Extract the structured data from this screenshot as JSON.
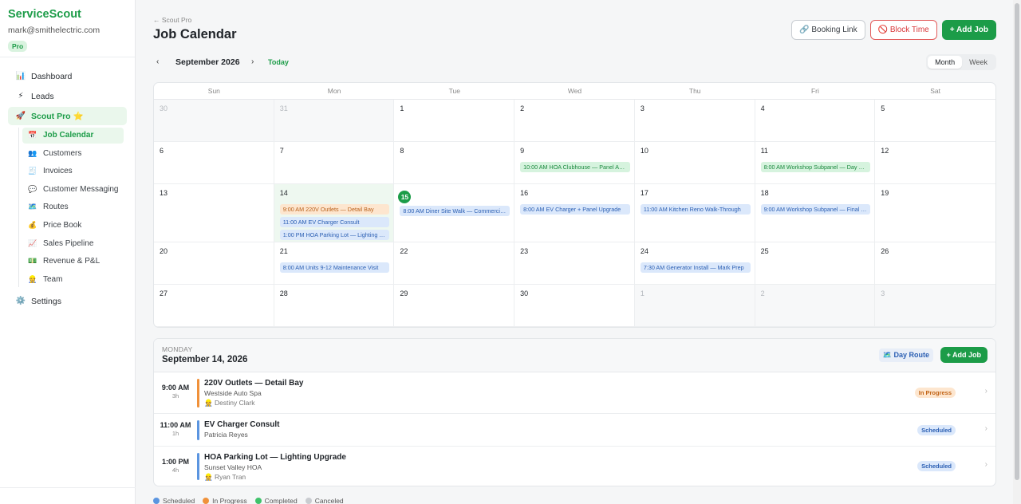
{
  "app": {
    "brand": "ServiceScout",
    "email": "mark@smithelectric.com",
    "plan": "Pro"
  },
  "sidebar": {
    "items": [
      {
        "name": "dashboard",
        "label": "Dashboard",
        "icon": "📊"
      },
      {
        "name": "leads",
        "label": "Leads",
        "icon": "⚡"
      },
      {
        "name": "scout-pro",
        "label": "Scout Pro ⭐",
        "icon": "🚀"
      }
    ],
    "sub_items": [
      {
        "name": "job-calendar",
        "label": "Job Calendar",
        "icon": "📅"
      },
      {
        "name": "customers",
        "label": "Customers",
        "icon": "👥"
      },
      {
        "name": "invoices",
        "label": "Invoices",
        "icon": "🧾"
      },
      {
        "name": "customer-messaging",
        "label": "Customer Messaging",
        "icon": "💬"
      },
      {
        "name": "routes",
        "label": "Routes",
        "icon": "🗺️"
      },
      {
        "name": "price-book",
        "label": "Price Book",
        "icon": "💰"
      },
      {
        "name": "sales-pipeline",
        "label": "Sales Pipeline",
        "icon": "📈"
      },
      {
        "name": "revenue-pl",
        "label": "Revenue & P&L",
        "icon": "💵"
      },
      {
        "name": "team",
        "label": "Team",
        "icon": "👷"
      }
    ],
    "settings": {
      "label": "Settings",
      "icon": "⚙️"
    }
  },
  "header": {
    "back_label": "← Scout Pro",
    "title": "Job Calendar",
    "booking_link": "🔗 Booking Link",
    "block_time": "🚫 Block Time",
    "add_job": "+ Add Job"
  },
  "month_bar": {
    "prev": "‹",
    "next": "›",
    "month": "September 2026",
    "today": "Today",
    "views": [
      "Month",
      "Week"
    ]
  },
  "calendar": {
    "weekdays": [
      "Sun",
      "Mon",
      "Tue",
      "Wed",
      "Thu",
      "Fri",
      "Sat"
    ],
    "weeks": [
      [
        {
          "d": "30",
          "other": true
        },
        {
          "d": "31",
          "other": true
        },
        {
          "d": "1"
        },
        {
          "d": "2"
        },
        {
          "d": "3"
        },
        {
          "d": "4"
        },
        {
          "d": "5"
        }
      ],
      [
        {
          "d": "6"
        },
        {
          "d": "7"
        },
        {
          "d": "8"
        },
        {
          "d": "9",
          "events": [
            {
              "text": "10:00 AM HOA Clubhouse — Panel Asse...",
              "status": "completed"
            }
          ]
        },
        {
          "d": "10"
        },
        {
          "d": "11",
          "events": [
            {
              "text": "8:00 AM Workshop Subpanel — Day 1 Ro...",
              "status": "completed"
            }
          ]
        },
        {
          "d": "12"
        }
      ],
      [
        {
          "d": "13"
        },
        {
          "d": "14",
          "selected": true,
          "events": [
            {
              "text": "9:00 AM 220V Outlets — Detail Bay",
              "status": "progress"
            },
            {
              "text": "11:00 AM EV Charger Consult",
              "status": "scheduled"
            },
            {
              "text": "1:00 PM HOA Parking Lot — Lighting Upg...",
              "status": "scheduled"
            }
          ]
        },
        {
          "d": "15",
          "today": true,
          "events": [
            {
              "text": "8:00 AM Diner Site Walk — Commercial ...",
              "status": "scheduled"
            }
          ]
        },
        {
          "d": "16",
          "events": [
            {
              "text": "8:00 AM EV Charger + Panel Upgrade",
              "status": "scheduled"
            }
          ]
        },
        {
          "d": "17",
          "events": [
            {
              "text": "11:00 AM Kitchen Reno Walk-Through",
              "status": "scheduled"
            }
          ]
        },
        {
          "d": "18",
          "events": [
            {
              "text": "9:00 AM Workshop Subpanel — Final Co...",
              "status": "scheduled"
            }
          ]
        },
        {
          "d": "19"
        }
      ],
      [
        {
          "d": "20"
        },
        {
          "d": "21",
          "events": [
            {
              "text": "8:00 AM Units 9-12 Maintenance Visit",
              "status": "scheduled"
            }
          ]
        },
        {
          "d": "22"
        },
        {
          "d": "23"
        },
        {
          "d": "24",
          "events": [
            {
              "text": "7:30 AM Generator Install — Mark Prep",
              "status": "scheduled"
            }
          ]
        },
        {
          "d": "25"
        },
        {
          "d": "26"
        }
      ],
      [
        {
          "d": "27"
        },
        {
          "d": "28"
        },
        {
          "d": "29"
        },
        {
          "d": "30"
        },
        {
          "d": "1",
          "other": true
        },
        {
          "d": "2",
          "other": true
        },
        {
          "d": "3",
          "other": true
        }
      ]
    ]
  },
  "day_panel": {
    "weekday": "MONDAY",
    "date": "September 14, 2026",
    "day_route": "🗺️ Day Route",
    "add_job": "+ Add Job",
    "jobs": [
      {
        "time": "9:00 AM",
        "duration": "3h",
        "title": "220V Outlets — Detail Bay",
        "customer": "Westside Auto Spa",
        "tech": "👷 Destiny Clark",
        "status": "In Progress",
        "status_key": "progress",
        "color": "#f0913a"
      },
      {
        "time": "11:00 AM",
        "duration": "1h",
        "title": "EV Charger Consult",
        "customer": "Patricia Reyes",
        "tech": "",
        "status": "Scheduled",
        "status_key": "scheduled",
        "color": "#5b95e0"
      },
      {
        "time": "1:00 PM",
        "duration": "4h",
        "title": "HOA Parking Lot — Lighting Upgrade",
        "customer": "Sunset Valley HOA",
        "tech": "👷 Ryan Tran",
        "status": "Scheduled",
        "status_key": "scheduled",
        "color": "#5b95e0"
      }
    ]
  },
  "legend": [
    {
      "label": "Scheduled",
      "color": "#5b95e0"
    },
    {
      "label": "In Progress",
      "color": "#f0913a"
    },
    {
      "label": "Completed",
      "color": "#3fc26a"
    },
    {
      "label": "Canceled",
      "color": "#c9ccd0"
    }
  ]
}
